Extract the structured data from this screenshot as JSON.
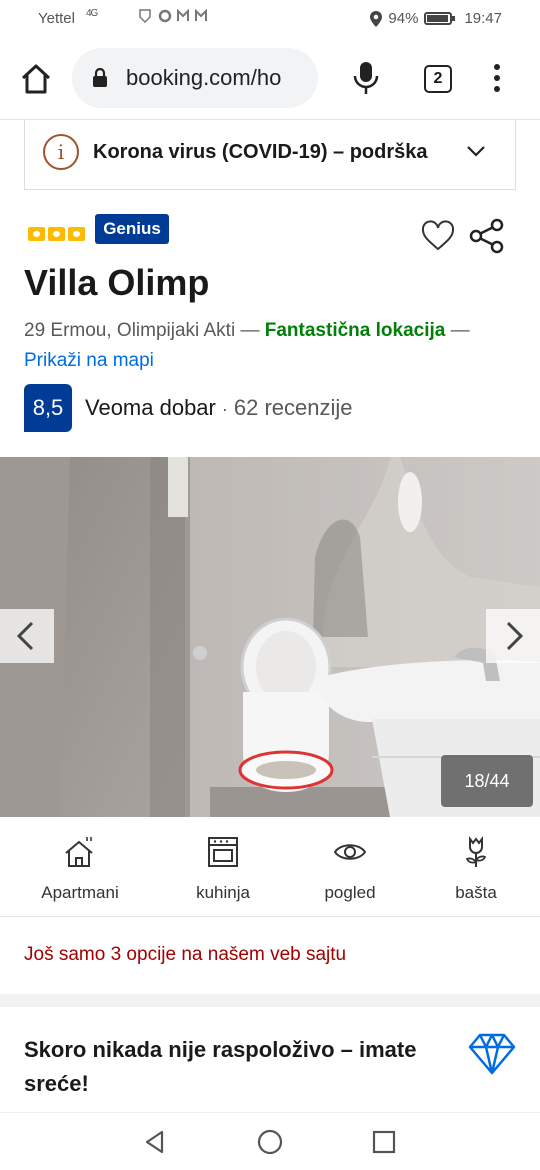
{
  "status_bar": {
    "carrier": "Yettel",
    "network": "4G",
    "battery": "94%",
    "time": "19:47"
  },
  "browser": {
    "url": "booking.com/ho",
    "tab_count": "2"
  },
  "covid_banner": {
    "text": "Korona virus (COVID-19) – podrška"
  },
  "property": {
    "badge": "Genius",
    "stars": 3,
    "name": "Villa Olimp",
    "address": "29 Ermou, Olimpijaki Akti —",
    "location_label": "Fantastična lokacija",
    "map_prefix": "—",
    "map_link": "Prikaži na mapi",
    "score": "8,5",
    "score_label": "Veoma dobar",
    "separator": "·",
    "reviews": "62 recenzije"
  },
  "gallery": {
    "counter": "18/44"
  },
  "facilities": [
    {
      "label": "Apartmani",
      "icon": "house-icon"
    },
    {
      "label": "kuhinja",
      "icon": "oven-icon"
    },
    {
      "label": "pogled",
      "icon": "eye-icon"
    },
    {
      "label": "bašta",
      "icon": "flower-icon"
    }
  ],
  "availability_note": "Još samo 3 opcije na našem veb sajtu",
  "rare_find": "Skoro nikada nije raspoloživo – imate sreće!",
  "colors": {
    "brand_blue": "#003b95",
    "link_blue": "#006ce4",
    "green": "#008009",
    "alert_red": "#a30000",
    "star_yellow": "#febb02"
  }
}
